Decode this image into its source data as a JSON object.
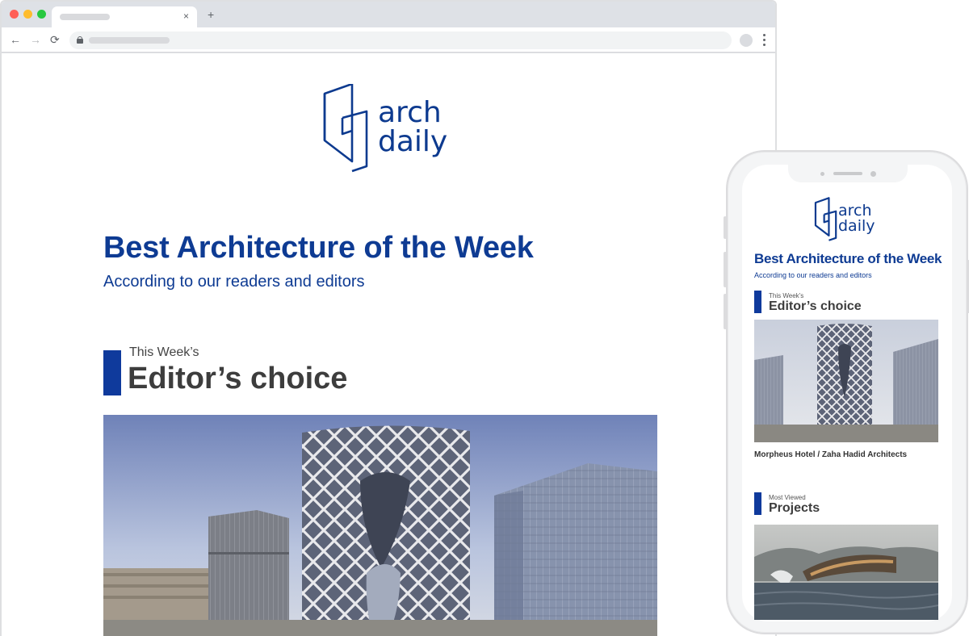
{
  "browser": {
    "tab_close": "×",
    "new_tab": "+",
    "back": "←",
    "forward": "→",
    "reload": "⟳"
  },
  "logo": {
    "line1": "arch",
    "line2": "daily",
    "color": "#0d3a8f"
  },
  "hero": {
    "title": "Best Architecture of the Week",
    "subtitle": "According to our readers and editors"
  },
  "editors_section": {
    "kicker": "This Week’s",
    "title": "Editor’s choice"
  },
  "mobile": {
    "title": "Best Architecture of the Week",
    "subtitle": "According to our readers and editors",
    "editors_kicker": "This Week’s",
    "editors_title": "Editor’s choice",
    "editors_caption": "Morpheus Hotel / Zaha Hadid Architects",
    "projects_kicker": "Most Viewed",
    "projects_title": "Projects"
  },
  "colors": {
    "brand_blue": "#0e3b93",
    "accent_bar": "#0f3a9c"
  }
}
